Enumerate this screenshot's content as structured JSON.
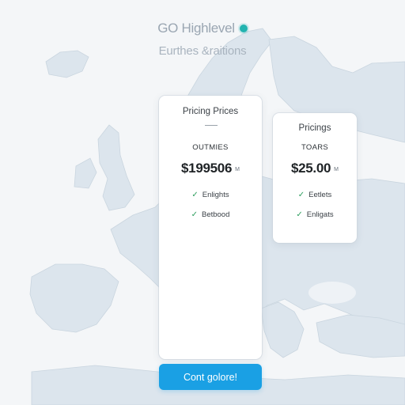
{
  "header": {
    "title": "GO Highlevel",
    "subtitle": "Eurthes &raitions",
    "status_icon": "teal-dot-icon"
  },
  "plans": [
    {
      "card_title": "Pricing Prices",
      "label": "OUTMIES",
      "price": "$199506",
      "price_suffix": "M",
      "features": [
        "Enlights",
        "Betbood"
      ]
    },
    {
      "card_title": "Pricings",
      "label": "TOARS",
      "price": "$25.00",
      "price_suffix": "M",
      "features": [
        "Eetlets",
        "Enligats"
      ]
    }
  ],
  "cta": {
    "label": "Cont golore!"
  },
  "colors": {
    "accent": "#1aa0e4",
    "brand_dot": "#22b3b0",
    "check": "#2e9e5e",
    "map_land": "#dbe4ec",
    "map_water": "#f4f6f8"
  }
}
